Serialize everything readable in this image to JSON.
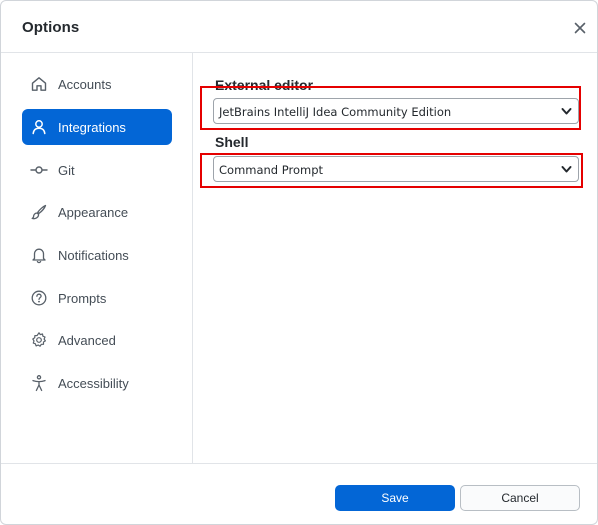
{
  "dialog": {
    "title": "Options",
    "close_icon": "close-icon"
  },
  "sidebar": {
    "items": [
      {
        "label": "Accounts",
        "icon": "home-icon",
        "selected": false
      },
      {
        "label": "Integrations",
        "icon": "person-icon",
        "selected": true
      },
      {
        "label": "Git",
        "icon": "git-commit-icon",
        "selected": false
      },
      {
        "label": "Appearance",
        "icon": "paintbrush-icon",
        "selected": false
      },
      {
        "label": "Notifications",
        "icon": "bell-icon",
        "selected": false
      },
      {
        "label": "Prompts",
        "icon": "question-icon",
        "selected": false
      },
      {
        "label": "Advanced",
        "icon": "gear-icon",
        "selected": false
      },
      {
        "label": "Accessibility",
        "icon": "accessibility-icon",
        "selected": false
      }
    ]
  },
  "integrations": {
    "external_editor": {
      "label": "External editor",
      "value": "JetBrains IntelliJ Idea Community Edition"
    },
    "shell": {
      "label": "Shell",
      "value": "Command Prompt"
    }
  },
  "footer": {
    "save_label": "Save",
    "cancel_label": "Cancel"
  },
  "colors": {
    "accent": "#0366d6",
    "highlight": "#e50000"
  }
}
